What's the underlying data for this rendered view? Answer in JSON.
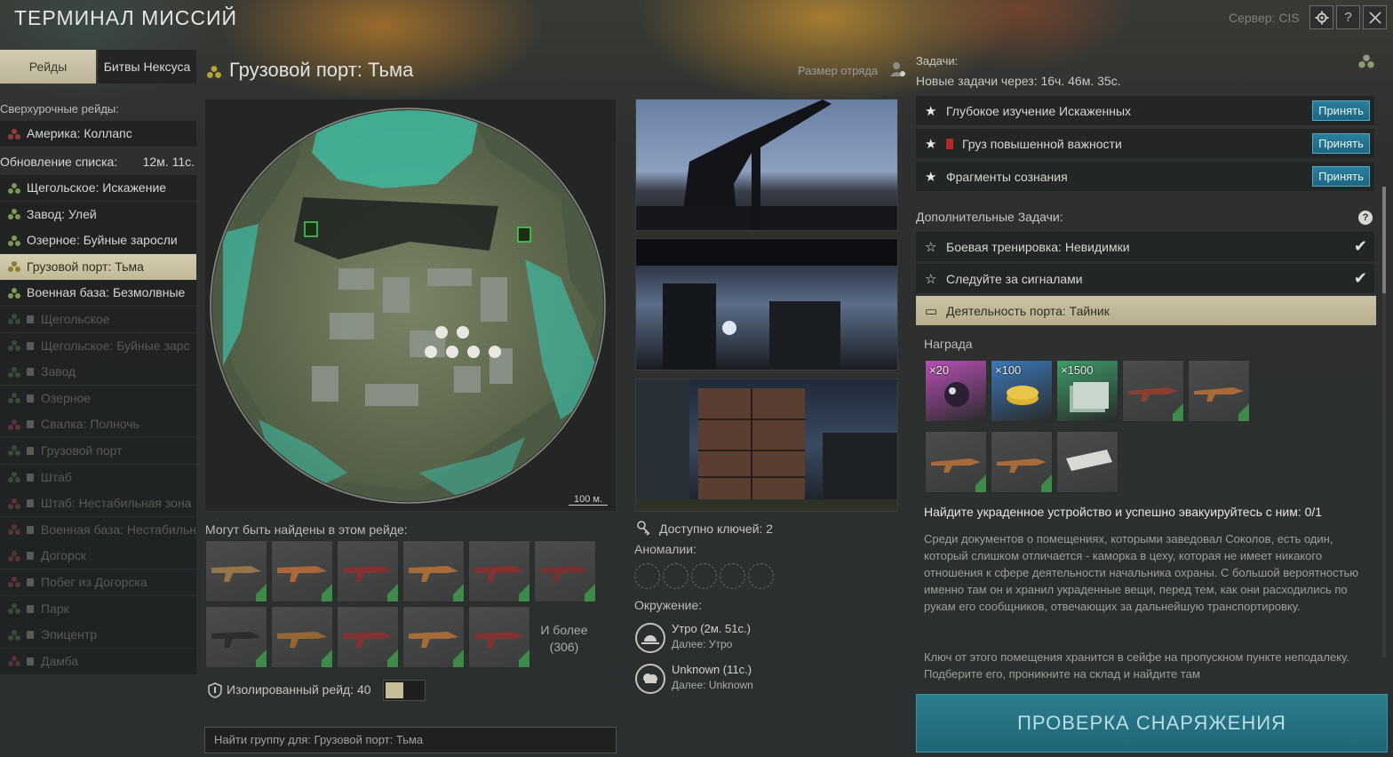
{
  "header": {
    "title": "ТЕРМИНАЛ МИССИЙ",
    "server": "Сервер: CIS",
    "buttons": [
      {
        "icon": "gear-icon"
      },
      {
        "icon": "help-icon",
        "label": "?"
      },
      {
        "icon": "close-icon"
      }
    ]
  },
  "tabs": [
    {
      "label": "Рейды",
      "active": true
    },
    {
      "label": "Битвы Нексуса",
      "active": false
    }
  ],
  "sidebar": {
    "special_header": "Сверхурочные рейды:",
    "special_items": [
      {
        "label": "Америка: Коллапс",
        "state": "red"
      }
    ],
    "update_label": "Обновление списка:",
    "update_time": "12м. 11с.",
    "items": [
      {
        "label": "Щегольское: Искажение",
        "state": "normal"
      },
      {
        "label": "Завод: Улей",
        "state": "normal"
      },
      {
        "label": "Озерное: Буйные заросли",
        "state": "normal"
      },
      {
        "label": "Грузовой порт: Тьма",
        "state": "selected"
      },
      {
        "label": "Военная база: Безмолвные",
        "state": "normal"
      },
      {
        "label": "Щегольское",
        "state": "locked"
      },
      {
        "label": "Щегольское: Буйные зарс",
        "state": "locked"
      },
      {
        "label": "Завод",
        "state": "locked"
      },
      {
        "label": "Озерное",
        "state": "locked"
      },
      {
        "label": "Свалка: Полночь",
        "state": "locked-red"
      },
      {
        "label": "Грузовой порт",
        "state": "locked"
      },
      {
        "label": "Штаб",
        "state": "locked"
      },
      {
        "label": "Штаб: Нестабильная зона",
        "state": "locked-red"
      },
      {
        "label": "Военная база: Нестабильн",
        "state": "locked-red"
      },
      {
        "label": "Догорск",
        "state": "locked-red"
      },
      {
        "label": "Побег из Догорска",
        "state": "locked-red"
      },
      {
        "label": "Парк",
        "state": "locked"
      },
      {
        "label": "Эпицентр",
        "state": "locked"
      },
      {
        "label": "Дамба",
        "state": "locked-red"
      }
    ]
  },
  "raid": {
    "title": "Грузовой порт: Тьма",
    "squad_label": "Размер отряда",
    "map_scale": "100 м.",
    "found_label": "Могут быть найдены в этом рейде:",
    "found_more": "И более",
    "found_more_count": "(306)",
    "isolated_label": "Изолированный рейд: 40",
    "isolated_on": true,
    "find_group_placeholder": "Найти группу для: Грузовой порт: Тьма",
    "keys_label": "Доступно ключей: 2",
    "anomalies_label": "Аномалии:",
    "environment_label": "Окружение:",
    "environment": [
      {
        "main": "Утро (2м. 51с.)",
        "next": "Далее: Утро",
        "icon": "sunrise-icon"
      },
      {
        "main": "Unknown (11с.)",
        "next": "Далее: Unknown",
        "icon": "weather-icon"
      }
    ]
  },
  "tasks": {
    "header": "Задачи:",
    "new_in": "Новые задачи через: 16ч. 46м. 35с.",
    "accept_label": "Принять",
    "main": [
      {
        "label": "Глубокое изучение Искаженных"
      },
      {
        "label": "Груз повышенной важности",
        "badge": "red-badge-icon"
      },
      {
        "label": "Фрагменты сознания"
      }
    ],
    "additional_header": "Дополнительные Задачи:",
    "additional": [
      {
        "label": "Боевая тренировка: Невидимки",
        "done": true
      },
      {
        "label": "Следуйте за сигналами",
        "done": true
      },
      {
        "label": "Деятельность порта: Тайник",
        "selected": true
      }
    ],
    "reward_label": "Награда",
    "rewards": [
      {
        "count": "×20",
        "kind": "crystals",
        "color": "#b84fb6"
      },
      {
        "count": "×100",
        "kind": "coins",
        "color": "#3b78b8"
      },
      {
        "count": "×1500",
        "kind": "cash",
        "color": "#3f9b6a"
      },
      {
        "count": "",
        "kind": "shotgun",
        "color": "#3c3f3e"
      },
      {
        "count": "",
        "kind": "rifle",
        "color": "#3c3f3e"
      },
      {
        "count": "",
        "kind": "ak-rifle",
        "color": "#3c3f3e"
      },
      {
        "count": "",
        "kind": "rifle-2",
        "color": "#3c3f3e"
      },
      {
        "count": "",
        "kind": "plate",
        "color": "#3c3f3e"
      }
    ],
    "objective": "Найдите украденное устройство и успешно эвакуируйтесь с ним: 0/1",
    "description": "Среди документов о помещениях, которыми заведовал Соколов, есть один, который слишком отличается - каморка в цеху, которая не имеет никакого отношения к сфере деятельности начальника охраны. С большой вероятностью именно там он и хранил украденные вещи, перед тем, как они расходились по рукам его сообщников, отвечающих за дальнейшую транспортировку.",
    "description2": "Ключ от этого помещения хранится в сейфе на пропускном пункте неподалеку. Подберите его, проникните на склад и найдите там",
    "gear_check": "ПРОВЕРКА СНАРЯЖЕНИЯ"
  },
  "colors": {
    "accent": "#1f6f86",
    "selected": "#c4bb98",
    "gear_button": "#2b7d8e"
  }
}
